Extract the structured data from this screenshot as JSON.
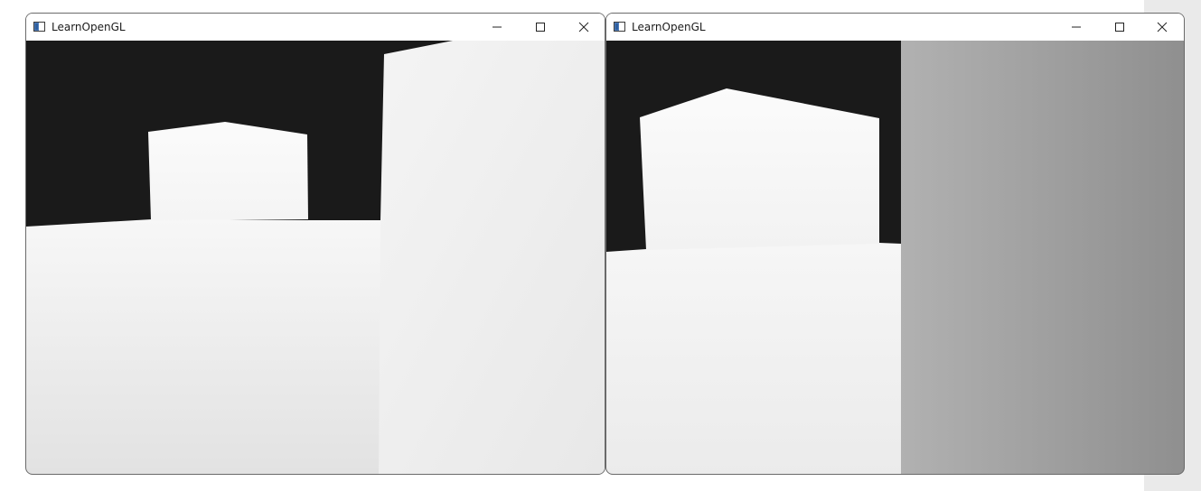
{
  "windows": [
    {
      "title": "LearnOpenGL",
      "icon": "app-window-icon",
      "controls": [
        "minimize-icon",
        "maximize-icon",
        "close-icon"
      ]
    },
    {
      "title": "LearnOpenGL",
      "icon": "app-window-icon",
      "controls": [
        "minimize-icon",
        "maximize-icon",
        "close-icon"
      ]
    }
  ],
  "colors": {
    "background_dark": "#1a1a1a",
    "scene_light": "#f6f6f6",
    "scene_gray_near": "#adadad",
    "scene_gray_far": "#8f8f8f",
    "side_panel": "#eaeaea"
  }
}
